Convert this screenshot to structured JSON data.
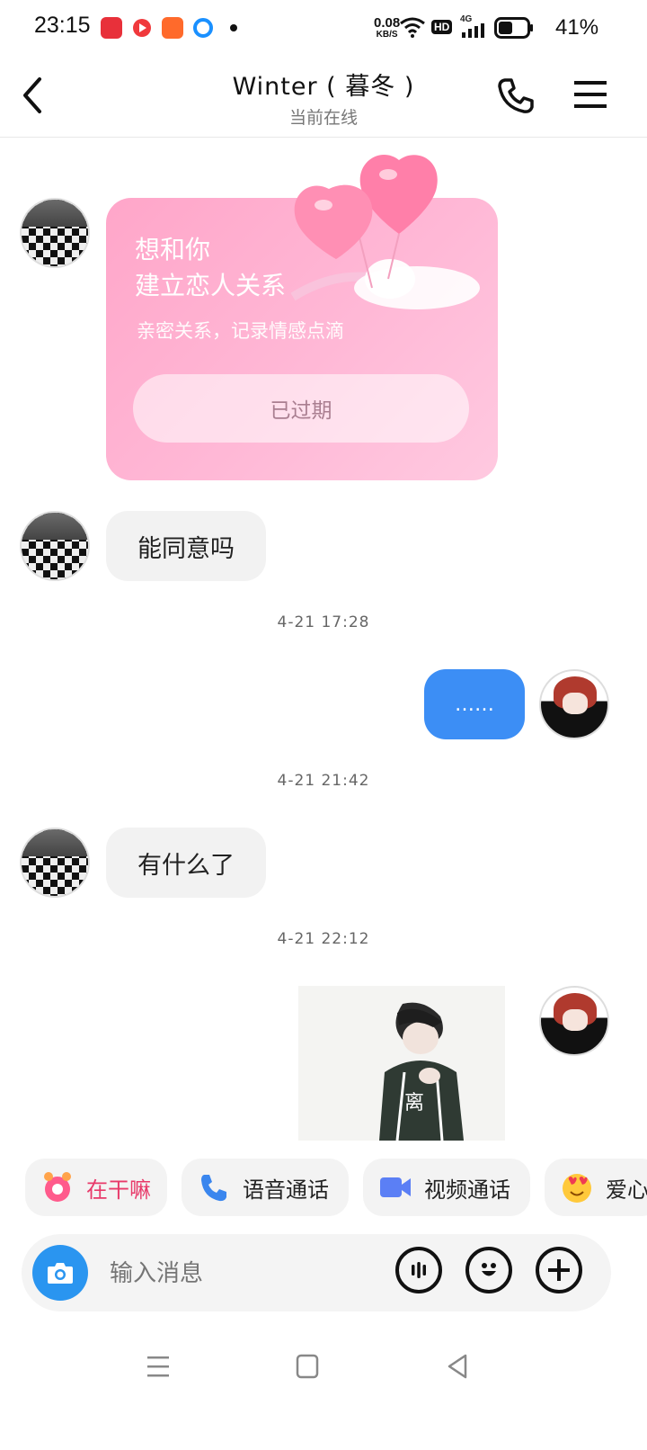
{
  "status_bar": {
    "time": "23:15",
    "net_speed_value": "0.08",
    "net_speed_unit": "KB/S",
    "hd": "HD",
    "network": "4G",
    "battery": "41%"
  },
  "header": {
    "title": "Winter ( 暮冬 )",
    "subtitle": "当前在线"
  },
  "love_card": {
    "title_line1": "想和你",
    "title_line2": "建立恋人关系",
    "subtitle": "亲密关系，记录情感点滴",
    "button": "已过期"
  },
  "messages": {
    "m1_text": "能同意吗",
    "ts1": "4-21 17:28",
    "m2_text": "……",
    "ts2": "4-21 21:42",
    "m3_text": "有什么了",
    "ts3": "4-21 22:12",
    "sticker_text": "离"
  },
  "quick_actions": {
    "a1": "在干嘛",
    "a2": "语音通话",
    "a3": "视频通话",
    "a4": "爱心"
  },
  "input": {
    "placeholder": "输入消息"
  },
  "colors": {
    "accent_blue": "#3c8ef5",
    "card_pink": "#ffb8d6"
  }
}
